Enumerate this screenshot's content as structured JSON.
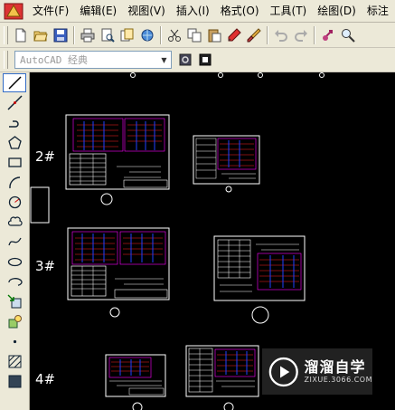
{
  "menu": {
    "items": [
      {
        "label": "文件(F)"
      },
      {
        "label": "编辑(E)"
      },
      {
        "label": "视图(V)"
      },
      {
        "label": "插入(I)"
      },
      {
        "label": "格式(O)"
      },
      {
        "label": "工具(T)"
      },
      {
        "label": "绘图(D)"
      },
      {
        "label": "标注"
      }
    ]
  },
  "toolbar": {
    "icons": [
      "new-file-icon",
      "open-folder-icon",
      "save-icon",
      "print-icon",
      "print-preview-icon",
      "publish-icon",
      "3d-dwf-icon",
      "cut-icon",
      "copy-icon",
      "paste-icon",
      "match-properties-icon",
      "brush-icon",
      "undo-icon",
      "redo-icon",
      "pan-icon",
      "zoom-realtime-icon"
    ]
  },
  "workspace": {
    "value": "AutoCAD 经典"
  },
  "drawbar": {
    "icons": [
      "line-icon",
      "construction-line-icon",
      "polyline-icon",
      "polygon-icon",
      "rectangle-icon",
      "arc-icon",
      "circle-icon",
      "revision-cloud-icon",
      "spline-icon",
      "ellipse-icon",
      "ellipse-arc-icon",
      "insert-block-icon",
      "make-block-icon",
      "point-icon",
      "hatch-icon",
      "gradient-icon"
    ]
  },
  "canvas": {
    "background": "#000000",
    "row_labels": [
      "2#",
      "3#",
      "4#"
    ]
  },
  "watermark": {
    "title": "溜溜自学",
    "url": "ZIXUE.3066.COM"
  },
  "colors": {
    "accent_magenta": "#ff00ff",
    "accent_red": "#ff2020",
    "accent_blue": "#2040ff",
    "line_white": "#ffffff"
  }
}
